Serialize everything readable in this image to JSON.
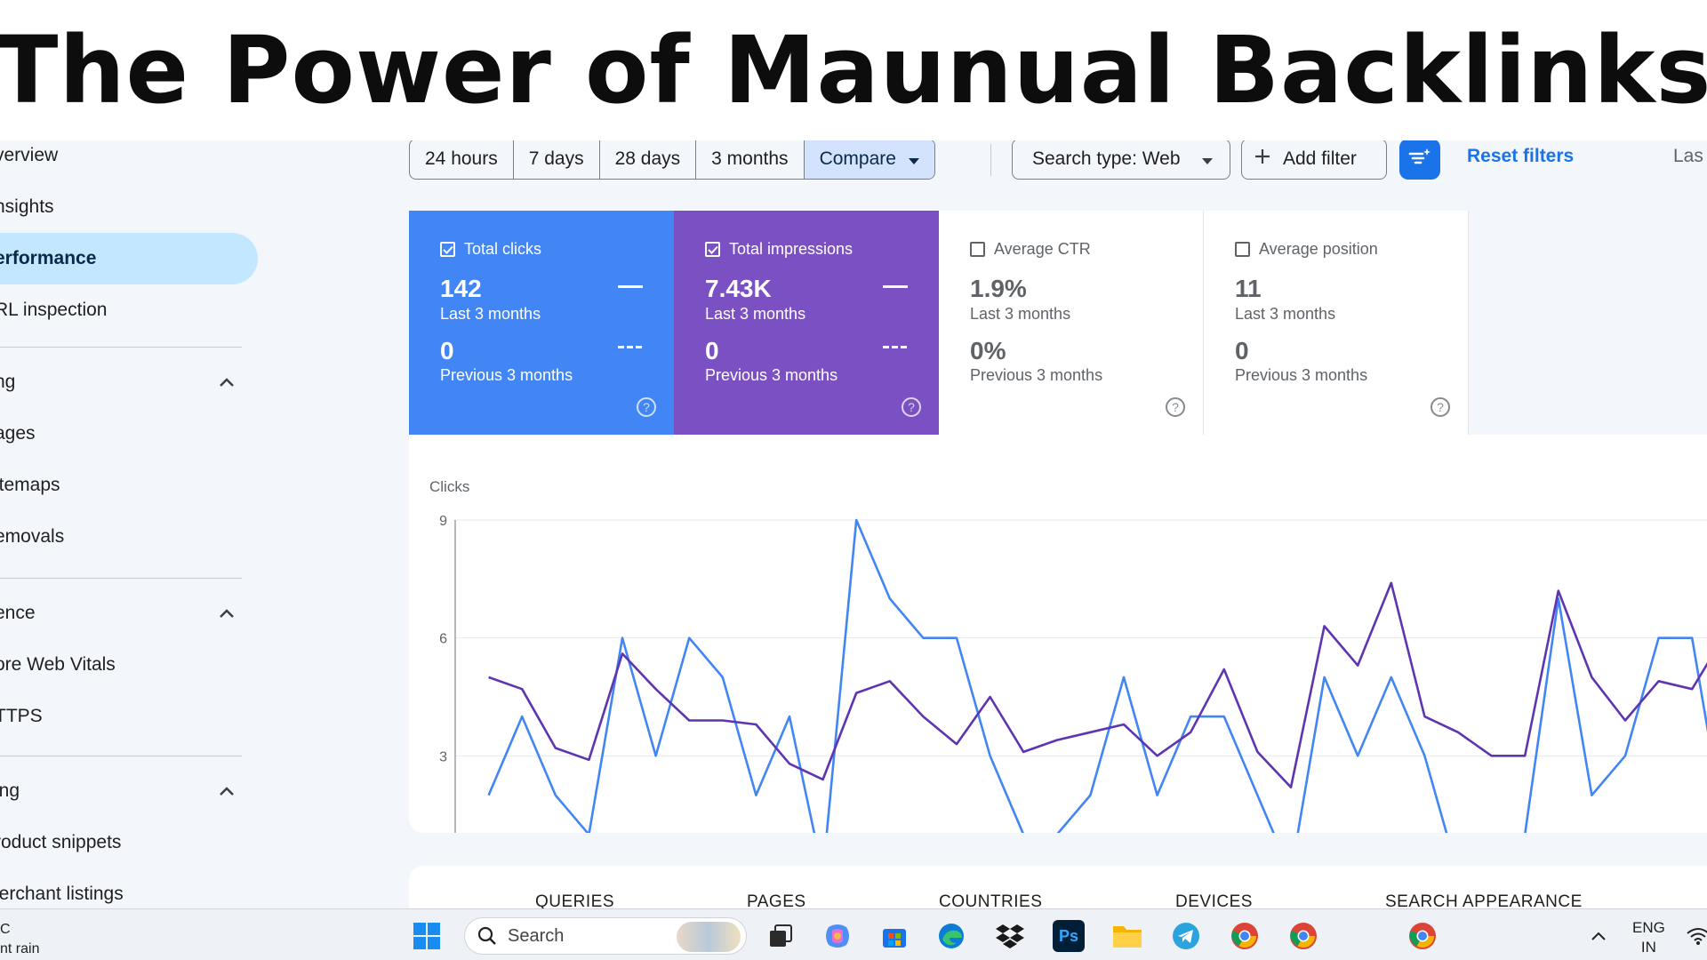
{
  "banner": {
    "title": "The Power of Maunual Backlinks"
  },
  "sidebar": {
    "items": [
      {
        "label": "verview"
      },
      {
        "label": "nsights"
      },
      {
        "label": "erformance"
      },
      {
        "label": "RL inspection"
      }
    ],
    "sections": [
      {
        "label": "ng",
        "children": [
          {
            "label": "ages"
          },
          {
            "label": "itemaps"
          },
          {
            "label": "emovals"
          }
        ]
      },
      {
        "label": "ence",
        "children": [
          {
            "label": "ore Web Vitals"
          },
          {
            "label": "TTPS"
          }
        ]
      },
      {
        "label": "ing",
        "children": [
          {
            "label": "roduct snippets"
          },
          {
            "label": "lerchant listings"
          }
        ]
      }
    ]
  },
  "toolbar": {
    "ranges": [
      "24 hours",
      "7 days",
      "28 days",
      "3 months"
    ],
    "compare_label": "Compare",
    "search_type_label": "Search type: Web",
    "add_filter_label": "Add filter",
    "reset_label": "Reset filters",
    "last_label": "Las"
  },
  "metrics": {
    "clicks": {
      "label": "Total clicks",
      "value": "142",
      "period": "Last 3 months",
      "prev_value": "0",
      "prev_period": "Previous 3 months",
      "checked": true
    },
    "impressions": {
      "label": "Total impressions",
      "value": "7.43K",
      "period": "Last 3 months",
      "prev_value": "0",
      "prev_period": "Previous 3 months",
      "checked": true
    },
    "ctr": {
      "label": "Average CTR",
      "value": "1.9%",
      "period": "Last 3 months",
      "prev_value": "0%",
      "prev_period": "Previous 3 months",
      "checked": false
    },
    "position": {
      "label": "Average position",
      "value": "11",
      "period": "Last 3 months",
      "prev_value": "0",
      "prev_period": "Previous 3 months",
      "checked": false
    }
  },
  "chart_data": {
    "type": "line",
    "ylabel": "Clicks",
    "ylim": [
      0,
      9
    ],
    "yticks": [
      0,
      3,
      6,
      9
    ],
    "xticks": [
      5,
      10,
      15,
      20,
      25,
      30,
      35
    ],
    "xlim": [
      0,
      38
    ],
    "grid": true,
    "colors": {
      "clicks": "#4285f4",
      "impressions": "#5e35b1"
    },
    "series": [
      {
        "key": "clicks",
        "x": [
          1,
          2,
          3,
          4,
          5,
          6,
          7,
          8,
          9,
          10,
          11,
          12,
          13,
          14,
          15,
          16,
          17,
          18,
          19,
          20,
          21,
          22,
          23,
          24,
          25,
          26,
          27,
          28,
          29,
          30,
          31,
          32,
          33,
          34,
          35,
          36,
          37,
          38
        ],
        "values": [
          2,
          4,
          2,
          1,
          6,
          3,
          6,
          5,
          2,
          4,
          0,
          9,
          7,
          6,
          6,
          3,
          1,
          1,
          2,
          5,
          2,
          4,
          4,
          2,
          0,
          5,
          3,
          5,
          3,
          0,
          1,
          1,
          7,
          2,
          3,
          6,
          6,
          1
        ]
      },
      {
        "key": "impressions",
        "x": [
          1,
          2,
          3,
          4,
          5,
          6,
          7,
          8,
          9,
          10,
          11,
          12,
          13,
          14,
          15,
          16,
          17,
          18,
          19,
          20,
          21,
          22,
          23,
          24,
          25,
          26,
          27,
          28,
          29,
          30,
          31,
          32,
          33,
          34,
          35,
          36,
          37,
          38
        ],
        "values": [
          5.0,
          4.7,
          3.2,
          2.9,
          5.6,
          4.7,
          3.9,
          3.9,
          3.8,
          2.8,
          2.4,
          4.6,
          4.9,
          4.0,
          3.3,
          4.5,
          3.1,
          3.4,
          3.6,
          3.8,
          3.0,
          3.6,
          5.2,
          3.1,
          2.2,
          6.3,
          5.3,
          7.4,
          4.0,
          3.6,
          3.0,
          3.0,
          7.2,
          5.0,
          3.9,
          4.9,
          4.7,
          6.1
        ]
      }
    ]
  },
  "tabs": [
    "QUERIES",
    "PAGES",
    "COUNTRIES",
    "DEVICES",
    "SEARCH APPEARANCE"
  ],
  "taskbar": {
    "weather_temp": "C",
    "weather_desc": "nt rain",
    "search_label": "Search",
    "lang_top": "ENG",
    "lang_bottom": "IN",
    "apps": [
      "windows-start",
      "task-view",
      "copilot",
      "microsoft-store",
      "edge",
      "dropbox",
      "photoshop",
      "file-explorer",
      "telegram",
      "chrome-profile-1",
      "chrome-profile-2",
      "chrome-profile-3"
    ],
    "ps_label": "Ps"
  }
}
